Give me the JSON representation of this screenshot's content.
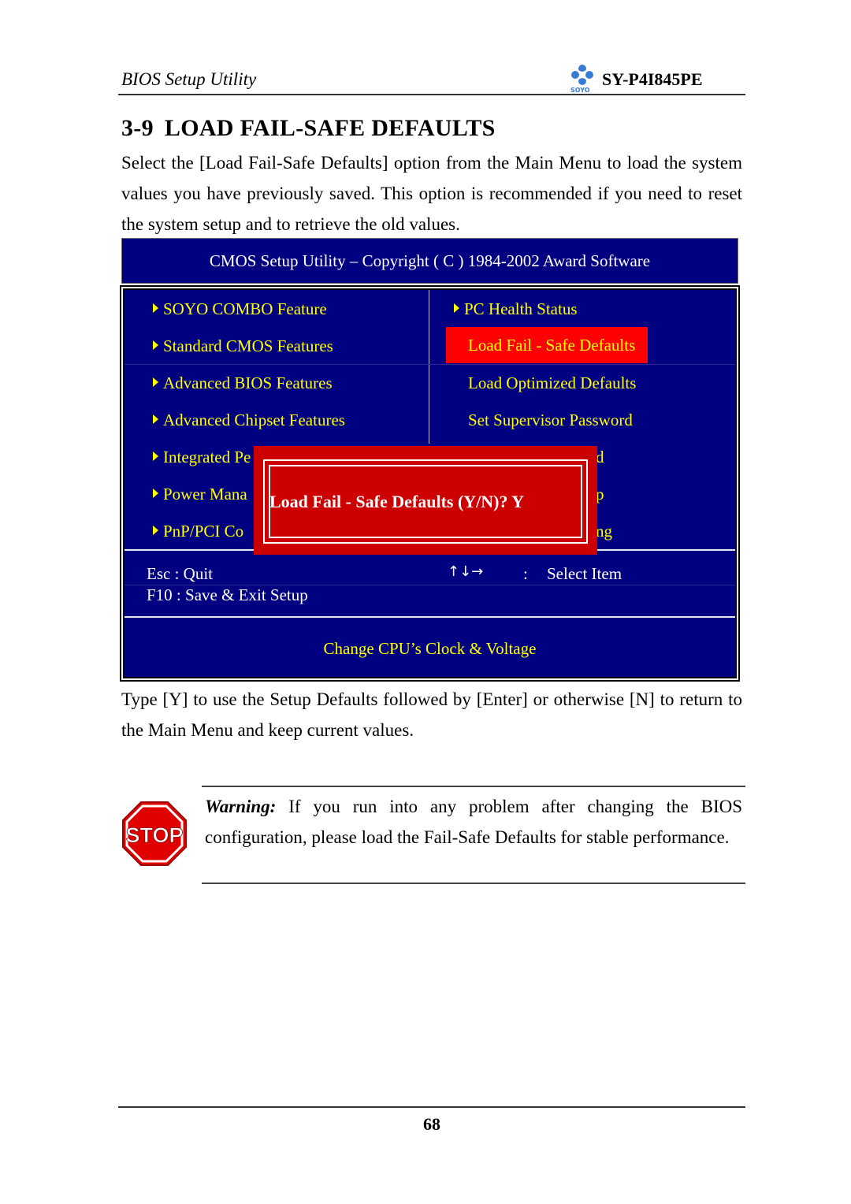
{
  "header": {
    "title": "BIOS Setup Utility",
    "logo_text": "SOYO",
    "model": "SY-P4I845PE"
  },
  "section": {
    "number": "3-9",
    "title": "LOAD FAIL-SAFE DEFAULTS",
    "intro": "Select the [Load Fail-Safe Defaults] option from the Main Menu to load the system values you have previously saved. This option is recommended if you need to reset the system setup and to retrieve the old values."
  },
  "bios": {
    "caption": "CMOS Setup Utility – Copyright ( C ) 1984-2002 Award Software",
    "colors": {
      "background": "#000080",
      "item_text": "#ffff00",
      "highlight": "#ff0000",
      "dialog": "#cc0000"
    },
    "left_menu": [
      {
        "label": "SOYO COMBO Feature",
        "submenu": true
      },
      {
        "label": "Standard CMOS Features",
        "submenu": true
      },
      {
        "label": "Advanced BIOS Features",
        "submenu": true
      },
      {
        "label": "Advanced Chipset Features",
        "submenu": true
      },
      {
        "label": "Integrated Pe",
        "submenu": true
      },
      {
        "label": "Power Mana",
        "submenu": true
      },
      {
        "label": "PnP/PCI Co",
        "submenu": true
      }
    ],
    "right_menu": [
      {
        "label": "PC Health Status",
        "submenu": true
      },
      {
        "label": "Load Fail - Safe Defaults",
        "selected": true
      },
      {
        "label": "Load Optimized Defaults"
      },
      {
        "label": "Set Supervisor Password"
      },
      {
        "label": "d"
      },
      {
        "label": "p"
      },
      {
        "label": "ng"
      }
    ],
    "keys": {
      "esc": "Esc : Quit",
      "f10": "F10 : Save & Exit Setup",
      "arrows": "↑↓→",
      "colon": ":",
      "select": "Select Item"
    },
    "hint": "Change CPU’s Clock & Voltage",
    "dialog": {
      "prompt": "Load Fail - Safe Defaults (Y/N)? Y"
    }
  },
  "after_text": "Type [Y] to use the Setup Defaults followed by [Enter] or otherwise [N] to return to the Main Menu and keep current values.",
  "warning": {
    "icon": "stop-sign-icon",
    "icon_text": "STOP",
    "label": "Warning:",
    "text": " If you run into any problem after changing the BIOS configuration, please load the Fail-Safe Defaults for stable performance."
  },
  "footer": {
    "page_number": "68"
  }
}
